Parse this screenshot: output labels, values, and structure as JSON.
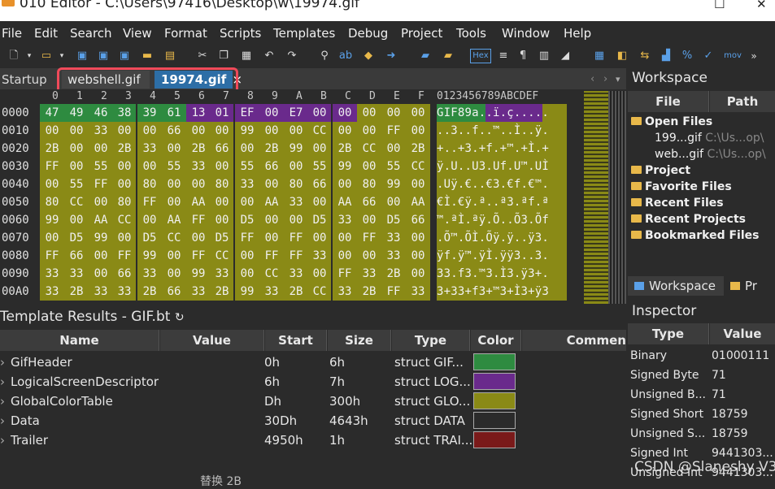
{
  "title": "010 Editor - C:\\Users\\97416\\Desktop\\w\\19974.gif",
  "window_controls": {
    "minimize": "–",
    "maximize": "☐",
    "close": "✕"
  },
  "menu": [
    "File",
    "Edit",
    "Search",
    "View",
    "Format",
    "Scripts",
    "Templates",
    "Debug",
    "Project",
    "Tools",
    "Window",
    "Help"
  ],
  "toolbar": {
    "hex_label": "Hex",
    "mov_label": "mov"
  },
  "tabs": {
    "startup": "Startup",
    "tab1": "webshell.gif",
    "tab2": "19974.gif",
    "tab2_close": "×"
  },
  "hex": {
    "columns": [
      "0",
      "1",
      "2",
      "3",
      "4",
      "5",
      "6",
      "7",
      "8",
      "9",
      "A",
      "B",
      "C",
      "D",
      "E",
      "F"
    ],
    "ascii_header": "0123456789ABCDEF",
    "rows": [
      {
        "offset": "0000",
        "bytes": [
          "47",
          "49",
          "46",
          "38",
          "39",
          "61",
          "13",
          "01",
          "EF",
          "00",
          "E7",
          "00",
          "00",
          "00",
          "00",
          "00"
        ],
        "ascii": "GIF89a..ï.ç....."
      },
      {
        "offset": "0010",
        "bytes": [
          "00",
          "00",
          "33",
          "00",
          "00",
          "66",
          "00",
          "00",
          "99",
          "00",
          "00",
          "CC",
          "00",
          "00",
          "FF",
          "00"
        ],
        "ascii": "..3..f..™..Ì..ÿ."
      },
      {
        "offset": "0020",
        "bytes": [
          "2B",
          "00",
          "00",
          "2B",
          "33",
          "00",
          "2B",
          "66",
          "00",
          "2B",
          "99",
          "00",
          "2B",
          "CC",
          "00",
          "2B"
        ],
        "ascii": "+..+3.+f.+™.+Ì.+"
      },
      {
        "offset": "0030",
        "bytes": [
          "FF",
          "00",
          "55",
          "00",
          "00",
          "55",
          "33",
          "00",
          "55",
          "66",
          "00",
          "55",
          "99",
          "00",
          "55",
          "CC"
        ],
        "ascii": "ÿ.U..U3.Uf.U™.UÌ"
      },
      {
        "offset": "0040",
        "bytes": [
          "00",
          "55",
          "FF",
          "00",
          "80",
          "00",
          "00",
          "80",
          "33",
          "00",
          "80",
          "66",
          "00",
          "80",
          "99",
          "00"
        ],
        "ascii": ".Uÿ.€..€3.€f.€™."
      },
      {
        "offset": "0050",
        "bytes": [
          "80",
          "CC",
          "00",
          "80",
          "FF",
          "00",
          "AA",
          "00",
          "00",
          "AA",
          "33",
          "00",
          "AA",
          "66",
          "00",
          "AA"
        ],
        "ascii": "€Ì.€ÿ.ª..ª3.ªf.ª"
      },
      {
        "offset": "0060",
        "bytes": [
          "99",
          "00",
          "AA",
          "CC",
          "00",
          "AA",
          "FF",
          "00",
          "D5",
          "00",
          "00",
          "D5",
          "33",
          "00",
          "D5",
          "66"
        ],
        "ascii": "™.ªÌ.ªÿ.Õ..Õ3.Õf"
      },
      {
        "offset": "0070",
        "bytes": [
          "00",
          "D5",
          "99",
          "00",
          "D5",
          "CC",
          "00",
          "D5",
          "FF",
          "00",
          "FF",
          "00",
          "00",
          "FF",
          "33",
          "00"
        ],
        "ascii": ".Õ™.ÕÌ.Õÿ.ÿ..ÿ3."
      },
      {
        "offset": "0080",
        "bytes": [
          "FF",
          "66",
          "00",
          "FF",
          "99",
          "00",
          "FF",
          "CC",
          "00",
          "FF",
          "FF",
          "33",
          "00",
          "00",
          "33",
          "00"
        ],
        "ascii": "ÿf.ÿ™.ÿÌ.ÿÿ3..3."
      },
      {
        "offset": "0090",
        "bytes": [
          "33",
          "33",
          "00",
          "66",
          "33",
          "00",
          "99",
          "33",
          "00",
          "CC",
          "33",
          "00",
          "FF",
          "33",
          "2B",
          "00"
        ],
        "ascii": "33.f3.™3.Ì3.ÿ3+."
      },
      {
        "offset": "00A0",
        "bytes": [
          "33",
          "2B",
          "33",
          "33",
          "2B",
          "66",
          "33",
          "2B",
          "99",
          "33",
          "2B",
          "CC",
          "33",
          "2B",
          "FF",
          "33"
        ],
        "ascii": "3+33+f3+™3+Ì3+ÿ3"
      }
    ]
  },
  "colors": {
    "green": "#2e8b40",
    "purple": "#6a2a8c",
    "olive": "#8a8a16",
    "dark": "#2b2b2b",
    "maroon": "#7a1a1a",
    "highlight": "#f04a5a"
  },
  "workspace": {
    "title": "Workspace",
    "col_file": "File",
    "col_path": "Path",
    "open_files": "Open Files",
    "files": [
      {
        "name": "199...gif",
        "path": "C:\\Us...op\\"
      },
      {
        "name": "web...gif",
        "path": "C:\\Us...op\\"
      }
    ],
    "project": "Project",
    "favorite": "Favorite Files",
    "recent": "Recent Files",
    "recent_projects": "Recent Projects",
    "bookmarked": "Bookmarked Files",
    "bottom_tab": "Workspace",
    "bottom_tab2": "Pr"
  },
  "inspector": {
    "title": "Inspector",
    "col_type": "Type",
    "col_value": "Value",
    "rows": [
      {
        "type": "Binary",
        "value": "01000111"
      },
      {
        "type": "Signed Byte",
        "value": "71"
      },
      {
        "type": "Unsigned B...",
        "value": "71"
      },
      {
        "type": "Signed Short",
        "value": "18759"
      },
      {
        "type": "Unsigned S...",
        "value": "18759"
      },
      {
        "type": "Signed Int",
        "value": "9441303..."
      },
      {
        "type": "Unsigned Int",
        "value": "9441303..."
      }
    ]
  },
  "template": {
    "title": "Template Results - GIF.bt",
    "refresh_icon": "↻",
    "headers": [
      "Name",
      "Value",
      "Start",
      "Size",
      "Type",
      "Color",
      "Commen"
    ],
    "rows": [
      {
        "name": "GifHeader",
        "value": "",
        "start": "0h",
        "size": "6h",
        "type": "struct GIF...",
        "color": "green"
      },
      {
        "name": "LogicalScreenDescriptor",
        "value": "",
        "start": "6h",
        "size": "7h",
        "type": "struct LOG...",
        "color": "purple"
      },
      {
        "name": "GlobalColorTable",
        "value": "",
        "start": "Dh",
        "size": "300h",
        "type": "struct GLO...",
        "color": "olive"
      },
      {
        "name": "Data",
        "value": "",
        "start": "30Dh",
        "size": "4643h",
        "type": "struct DATA",
        "color": "dark"
      },
      {
        "name": "Trailer",
        "value": "",
        "start": "4950h",
        "size": "1h",
        "type": "struct TRAI...",
        "color": "maroon"
      }
    ],
    "bottom_text": "替换 2B"
  },
  "watermark": "CSDN @Slaneshy V3"
}
